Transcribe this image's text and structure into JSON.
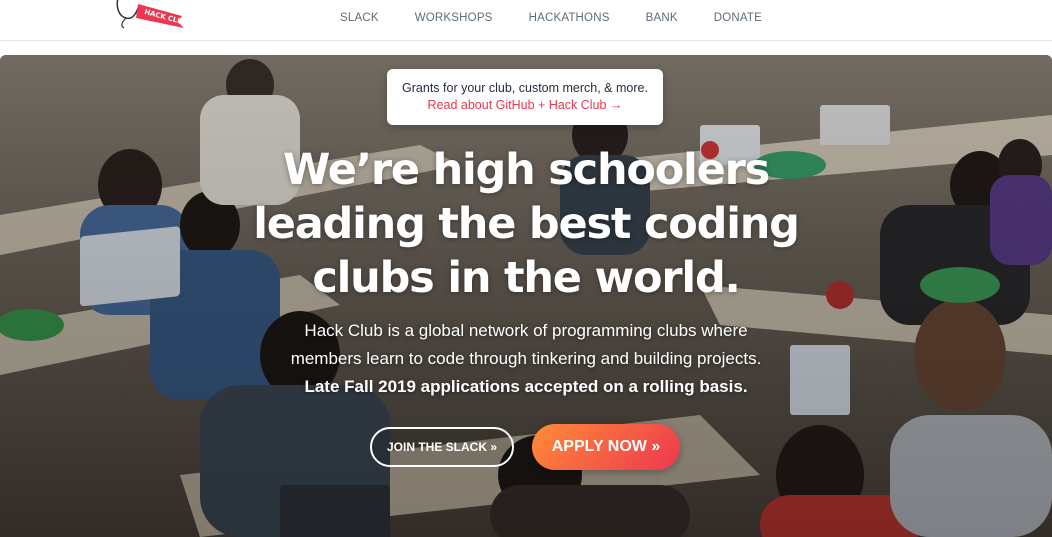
{
  "brand": {
    "logo_text": "HACK CLUB",
    "accent": "#ec3750",
    "accent_gradient_start": "#ff8c37"
  },
  "nav": {
    "items": [
      {
        "label": "SLACK"
      },
      {
        "label": "WORKSHOPS"
      },
      {
        "label": "HACKATHONS"
      },
      {
        "label": "BANK"
      },
      {
        "label": "DONATE"
      }
    ]
  },
  "announcement": {
    "text": "Grants for your club, custom merch, & more.",
    "link": "Read about GitHub + Hack Club →"
  },
  "hero": {
    "headline": [
      "We’re high schoolers",
      "leading the best coding",
      "clubs in the world."
    ],
    "subtext": [
      "Hack Club is a global network of programming clubs where",
      "members learn to code through tinkering and building projects."
    ],
    "callout": "Late Fall 2019 applications accepted on a rolling basis.",
    "buttons": {
      "slack": "JOIN THE SLACK »",
      "apply": "APPLY NOW »"
    }
  }
}
